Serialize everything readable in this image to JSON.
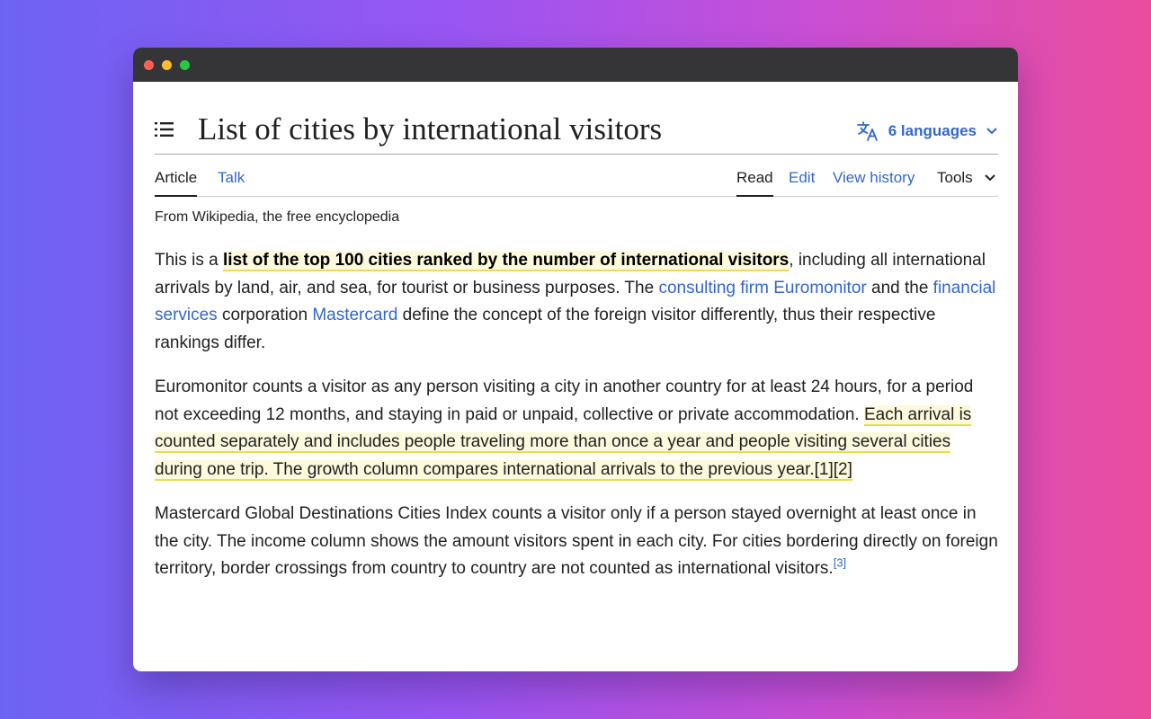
{
  "window": {
    "controls": [
      "close",
      "minimize",
      "maximize"
    ]
  },
  "page": {
    "title": "List of cities by international visitors",
    "languages_label": "6 languages"
  },
  "tabs": {
    "article": "Article",
    "talk": "Talk",
    "read": "Read",
    "edit": "Edit",
    "view_history": "View history",
    "tools": "Tools"
  },
  "tagline": "From Wikipedia, the free encyclopedia",
  "paragraphs": {
    "p1": {
      "t1": "This is a ",
      "bold": "list of the top 100 cities ranked by the number of international visitors",
      "t2": ", including all international arrivals by land, air, and sea, for tourist or business purposes. The ",
      "link1": "consulting firm",
      "t3": " ",
      "link2": "Euromonitor",
      "t4": " and the ",
      "link3": "financial services",
      "t5": " corporation ",
      "link4": "Mastercard",
      "t6": " define the concept of the foreign visitor differently, thus their respective rankings differ."
    },
    "p2": {
      "t1": "Euromonitor counts a visitor as any person visiting a city in another country for at least 24 hours, for a period not exceeding 12 months, and staying in paid or unpaid, collective or private accommodation. ",
      "highlight": "Each arrival is counted separately and includes people traveling more than once a year and people visiting several cities during one trip. The growth column compares international arrivals to the previous year.[1][2]"
    },
    "p3": {
      "t1": "Mastercard Global Destinations Cities Index counts a visitor only if a person stayed overnight at least once in the city. The income column shows the amount visitors spent in each city. For cities bordering directly on foreign territory, border crossings from country to country are not counted as international visitors.",
      "ref": "[3]"
    }
  },
  "colors": {
    "link": "#3366cc",
    "text": "#202122",
    "highlight_bg": "#fdf9dc",
    "highlight_underline": "#e8dc55",
    "titlebar": "#353437"
  },
  "icons": {
    "toc": "list-icon",
    "language": "translate-icon",
    "dropdown": "chevron-down-icon"
  }
}
